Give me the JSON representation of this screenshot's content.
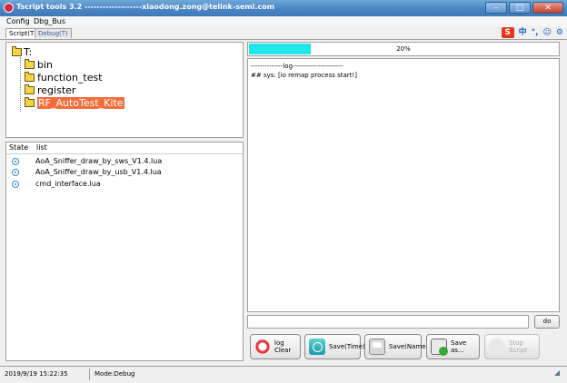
{
  "window": {
    "title": "Tscript tools 3.2 -------------------xiaodong.zong@telink-semi.com"
  },
  "menu": {
    "items": [
      "Config",
      "Dbg_Bus"
    ]
  },
  "tabs": [
    {
      "label": "Script(T)",
      "active": true
    },
    {
      "label": "Debug(T)",
      "active": false
    }
  ],
  "ime": {
    "logo": "S",
    "lang": "中",
    "punct": "°,",
    "emoji": "☺",
    "settings": "⚙"
  },
  "tree": {
    "root": "T:",
    "items": [
      {
        "label": "bin",
        "selected": false
      },
      {
        "label": "function_test",
        "selected": false
      },
      {
        "label": "register",
        "selected": false
      },
      {
        "label": "RF_AutoTest_Kite",
        "selected": true
      }
    ]
  },
  "scripts": {
    "columns": [
      "State",
      "list"
    ],
    "rows": [
      {
        "name": "AoA_Sniffer_draw_by_sws_V1.4.lua"
      },
      {
        "name": "AoA_Sniffer_draw_by_usb_V1.4.lua"
      },
      {
        "name": "cmd_interface.lua"
      }
    ]
  },
  "progress": {
    "value": 0.2,
    "label": "20%",
    "fill_color": "#1ee6e9"
  },
  "log": {
    "lines": [
      "--------------log----------------------",
      "## sys: [io remap process start!]"
    ]
  },
  "command": {
    "value": "",
    "do_label": "do"
  },
  "toolbar": {
    "log_clear": "log Clear",
    "save_time": "Save(Time)",
    "save_name": "Save(Name)",
    "save_as": "Save as...",
    "stop_script": "Stop Script"
  },
  "status": {
    "datetime": "2019/9/19 15:22:35",
    "mode": "Mode:Debug"
  }
}
